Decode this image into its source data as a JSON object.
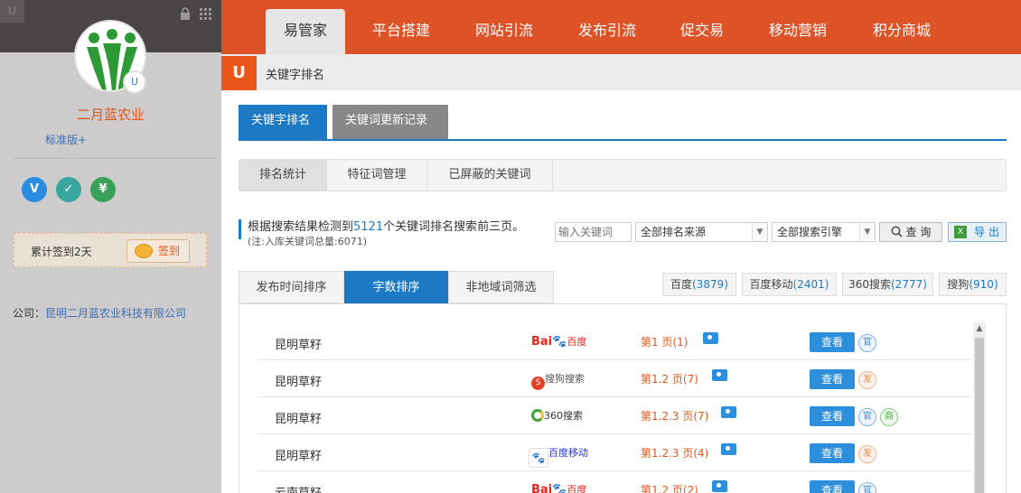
{
  "sidebar": {
    "company_name": "二月蓝农业",
    "edition": "标准版+",
    "badges": [
      {
        "icon": "v-verify-icon",
        "label": "V",
        "color": "#2b8de0"
      },
      {
        "icon": "shield-icon",
        "label": "✓",
        "color": "#3aa6a0"
      },
      {
        "icon": "yuan-icon",
        "label": "¥",
        "color": "#3aa15a"
      }
    ],
    "checkin_text": "累计签到2天",
    "checkin_button": "签到",
    "company_label": "公司：",
    "company_link": "昆明二月蓝农业科技有限公司"
  },
  "topnav": {
    "items": [
      "易管家",
      "平台搭建",
      "网站引流",
      "发布引流",
      "促交易",
      "移动营销",
      "积分商城"
    ],
    "active_index": 0
  },
  "breadcrumb": "关键字排名",
  "tabs": [
    "关键字排名",
    "关键词更新记录"
  ],
  "subtabs": [
    "排名统计",
    "特征词管理",
    "已屏蔽的关键词"
  ],
  "info": {
    "prefix": "根据搜索结果检测到",
    "count": "5121",
    "suffix": "个关键词排名搜索前三页。",
    "note": "(注:入库关键词总量:6071)"
  },
  "filters": {
    "keyword_placeholder": "输入关键词",
    "source_select": "全部排名来源",
    "engine_select": "全部搜索引擎",
    "query_button": "查 询",
    "export_button": "导 出"
  },
  "sort_tabs": [
    "发布时间排序",
    "字数排序",
    "非地域词筛选"
  ],
  "engine_counts": [
    {
      "name": "百度",
      "count": "(3879)"
    },
    {
      "name": "百度移动",
      "count": "(2401)"
    },
    {
      "name": "360搜索",
      "count": "(2777)"
    },
    {
      "name": "搜狗",
      "count": "(910)"
    }
  ],
  "rows": [
    {
      "keyword": "昆明草籽",
      "engine": "Bai百度",
      "engine_icon": "baidu-logo",
      "rank": "第1 页(1)",
      "view": "查看",
      "tags": [
        "官"
      ]
    },
    {
      "keyword": "昆明草籽",
      "engine": "搜狗搜索",
      "engine_icon": "sogou-logo",
      "rank": "第1.2 页(7)",
      "view": "查看",
      "tags": [
        "发"
      ]
    },
    {
      "keyword": "昆明草籽",
      "engine": "360搜索",
      "engine_icon": "so360-logo",
      "rank": "第1.2.3 页(7)",
      "view": "查看",
      "tags": [
        "官",
        "商"
      ]
    },
    {
      "keyword": "昆明草籽",
      "engine": "百度移动",
      "engine_icon": "baidu-mobile-logo",
      "rank": "第1.2.3 页(4)",
      "view": "查看",
      "tags": [
        "发"
      ]
    },
    {
      "keyword": "云南草籽",
      "engine": "Bai百度",
      "engine_icon": "baidu-logo",
      "rank": "第1.2 页(2)",
      "view": "查看",
      "tags": [
        "官"
      ]
    }
  ],
  "colors": {
    "brand_orange": "#dd5226",
    "primary_blue": "#1c7ac4",
    "rank_red": "#e2561b"
  }
}
